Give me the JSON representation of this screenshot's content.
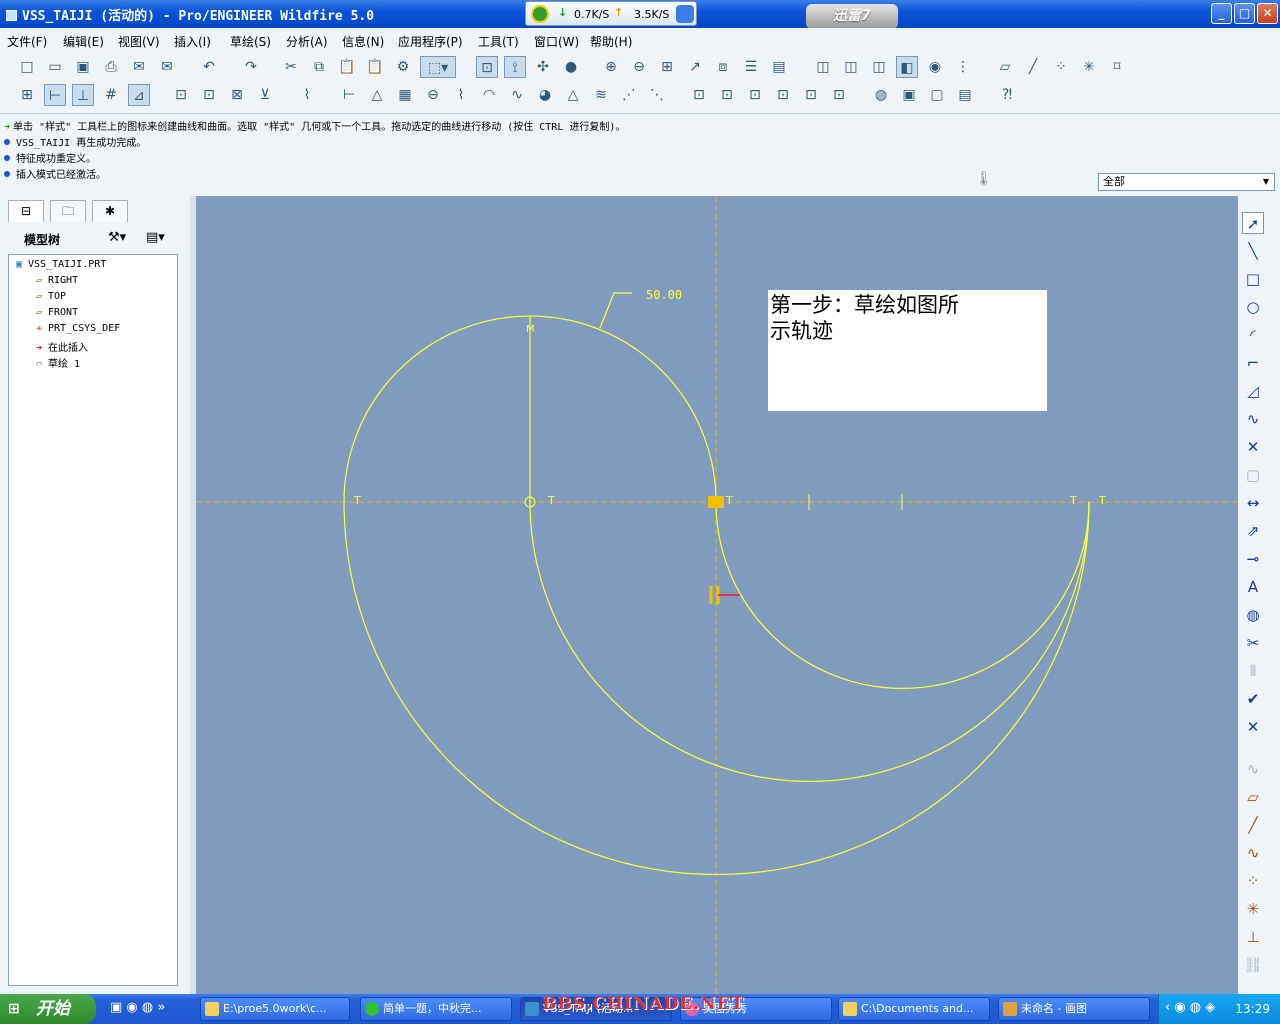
{
  "window": {
    "title": "VSS_TAIJI (活动的) - Pro/ENGINEER Wildfire 5.0",
    "min": "_",
    "max": "□",
    "close": "✕"
  },
  "netspeed": {
    "down": "0.7K/S",
    "up": "3.5K/S"
  },
  "xunlei": {
    "label": "迅雷7"
  },
  "menu": [
    "文件(F)",
    "编辑(E)",
    "视图(V)",
    "插入(I)",
    "草绘(S)",
    "分析(A)",
    "信息(N)",
    "应用程序(P)",
    "工具(T)",
    "窗口(W)",
    "帮助(H)"
  ],
  "messages": [
    "单击 \"样式\" 工具栏上的图标来创建曲线和曲面。选取 \"样式\" 几何或下一个工具。拖动选定的曲线进行移动 (按住 CTRL 进行复制)。",
    "VSS_TAIJI 再生成功完成。",
    "特征成功重定义。",
    "插入模式已经激活。"
  ],
  "filter": {
    "value": "全部"
  },
  "model_tree": {
    "heading": "模型树",
    "items": [
      {
        "label": "VSS_TAIJI.PRT",
        "icon": "part-icon"
      },
      {
        "label": "RIGHT",
        "icon": "datum-plane-icon"
      },
      {
        "label": "TOP",
        "icon": "datum-plane-icon"
      },
      {
        "label": "FRONT",
        "icon": "datum-plane-icon"
      },
      {
        "label": "PRT_CSYS_DEF",
        "icon": "csys-icon"
      },
      {
        "label": "在此插入",
        "icon": "insert-arrow-icon"
      },
      {
        "label": "草绘 1",
        "icon": "sketch-icon"
      }
    ]
  },
  "sketch": {
    "dimension": "50.00",
    "note": [
      "第一步：草绘如图所",
      "示轨迹"
    ],
    "line_color": "#ffff33",
    "ref_color": "#e8b800",
    "background": "#7f9bbd"
  },
  "taskbar": {
    "start": "开始",
    "tasks": [
      "E:\\proe5.0work\\c...",
      "简单一题，中秋完...",
      "VSS_TAIJI (活动...",
      "美图秀秀",
      "C:\\Documents and...",
      "未命名 - 画图"
    ],
    "clock": "13:29"
  },
  "watermark": "BBS.CHINADE.NET"
}
